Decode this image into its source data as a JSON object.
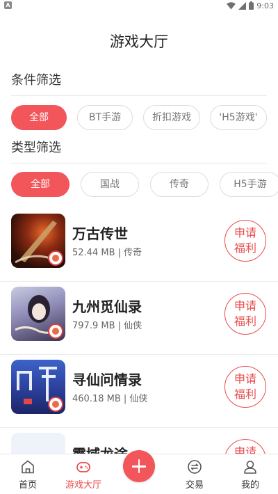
{
  "status_bar": {
    "time": "9:03",
    "app_glyph": "A"
  },
  "page": {
    "title": "游戏大厅"
  },
  "filters": {
    "condition_label": "条件筛选",
    "condition_chips": [
      "全部",
      "BT手游",
      "折扣游戏",
      "'H5游戏'"
    ],
    "type_label": "类型筛选",
    "type_chips": [
      "全部",
      "国战",
      "传奇",
      "H5手游"
    ]
  },
  "games": [
    {
      "name": "万古传世",
      "size": "52.44 MB",
      "category": "传奇",
      "apply_label_1": "申请",
      "apply_label_2": "福利"
    },
    {
      "name": "九州觅仙录",
      "size": "797.9 MB",
      "category": "仙侠",
      "apply_label_1": "申请",
      "apply_label_2": "福利"
    },
    {
      "name": "寻仙问情录",
      "size": "460.18 MB",
      "category": "仙侠",
      "apply_label_1": "申请",
      "apply_label_2": "福利"
    },
    {
      "name": "霸域龙途",
      "apply_label_1": "申请"
    }
  ],
  "tabbar": {
    "items": [
      {
        "label": "首页",
        "icon": "home-icon"
      },
      {
        "label": "游戏大厅",
        "icon": "gamepad-icon",
        "active": true
      },
      {
        "label": "",
        "icon": "plus-icon"
      },
      {
        "label": "交易",
        "icon": "exchange-icon"
      },
      {
        "label": "我的",
        "icon": "user-icon"
      }
    ]
  },
  "colors": {
    "accent": "#f2555a",
    "accent_text": "#e94b4b"
  }
}
